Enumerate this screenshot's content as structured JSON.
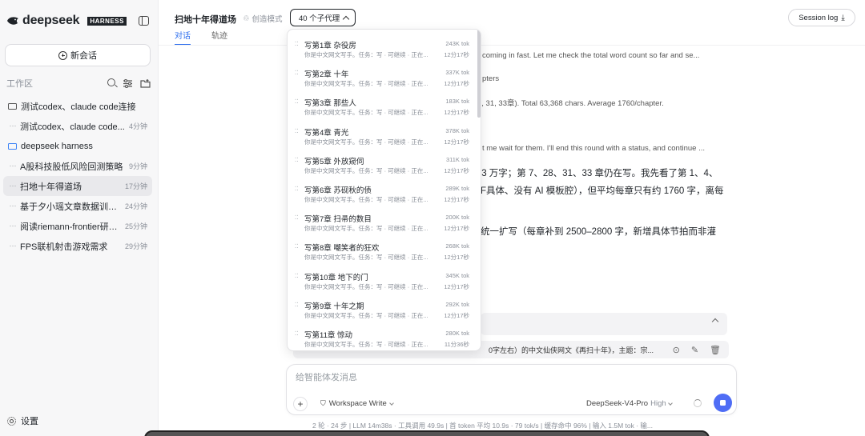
{
  "sidebar": {
    "brand": "deepseek",
    "badge": "HARNESS",
    "new_chat": "新会话",
    "workspace_label": "工作区",
    "items": [
      {
        "label": "测试codex、claude code连接",
        "time": "",
        "type": "folder"
      },
      {
        "label": "测试codex、claude code...",
        "time": "4分钟",
        "type": "session"
      },
      {
        "label": "deepseek harness",
        "time": "",
        "type": "folder-blue"
      },
      {
        "label": "A股科技股低风险回测策略",
        "time": "9分钟",
        "type": "session"
      },
      {
        "label": "扫地十年得道场",
        "time": "17分钟",
        "type": "session",
        "active": true
      },
      {
        "label": "基于夕小瑶文章数据训练...",
        "time": "24分钟",
        "type": "session"
      },
      {
        "label": "阅读riemann-frontier研究...",
        "time": "25分钟",
        "type": "session"
      },
      {
        "label": "FPS联机射击游戏需求",
        "time": "29分钟",
        "type": "session"
      }
    ],
    "settings": "设置"
  },
  "header": {
    "title": "扫地十年得道场",
    "mode": "创造模式",
    "agents": "40 个子代理",
    "tabs": [
      "对话",
      "轨迹"
    ],
    "session_log": "Session log"
  },
  "background": {
    "line1": "coming in fast. Let me check the total word count so far and se...",
    "line2": "pters",
    "line3": "8, 31, 33章). Total 63,368 chars. Average 1760/chapter.",
    "line4": "t me wait for them. I'll end this round with a status, and continue ...",
    "line5": ".3 万字；第 7、28、31、33 章仍在写。我先看了第 1、4、",
    "line6": "F具体、没有 AI 模板腔），但平均每章只有约 1760 字，离每",
    "line7": "统一扩写（每章补到 2500–2800 字，新增具体节拍而非灌",
    "task": "0字左右）的中文仙侠网文《再扫十年》，主题：宗..."
  },
  "composer": {
    "placeholder": "给智能体发消息",
    "mode": "Workspace Write",
    "model": "DeepSeek-V4-Pro",
    "level": "High"
  },
  "stats": "2 轮 · 24 步  |  LLM 14m38s · 工具调用 49.9s  |  首 token 平均 10.9s · 79 tok/s  |  缓存命中 96%  |  输入 1.5M tok · 输...",
  "dropdown": {
    "items": [
      {
        "title": "写第1章 杂役房",
        "desc": "你是中文网文写手。任务：写 · 可继续 · 正在...",
        "tok": "243K tok",
        "time": "12分17秒"
      },
      {
        "title": "写第2章 十年",
        "desc": "你是中文网文写手。任务：写 · 可继续 · 正在...",
        "tok": "337K tok",
        "time": "12分17秒"
      },
      {
        "title": "写第3章 那些人",
        "desc": "你是中文网文写手。任务：写 · 可继续 · 正在...",
        "tok": "183K tok",
        "time": "12分17秒"
      },
      {
        "title": "写第4章 青光",
        "desc": "你是中文网文写手。任务：写 · 可继续 · 正在...",
        "tok": "378K tok",
        "time": "12分17秒"
      },
      {
        "title": "写第5章 外放窥伺",
        "desc": "你是中文网文写手。任务：写 · 可继续 · 正在...",
        "tok": "311K tok",
        "time": "12分17秒"
      },
      {
        "title": "写第6章 苏砚秋的债",
        "desc": "你是中文网文写手。任务：写 · 可继续 · 正在...",
        "tok": "289K tok",
        "time": "12分17秒"
      },
      {
        "title": "写第7章 扫帚的数目",
        "desc": "你是中文网文写手。任务：写 · 可继续 · 正在...",
        "tok": "200K tok",
        "time": "12分17秒"
      },
      {
        "title": "写第8章 嘲笑者的狂欢",
        "desc": "你是中文网文写手。任务：写 · 可继续 · 正在...",
        "tok": "268K tok",
        "time": "12分17秒"
      },
      {
        "title": "写第10章 地下的门",
        "desc": "你是中文网文写手。任务：写 · 可继续 · 正在...",
        "tok": "345K tok",
        "time": "12分17秒"
      },
      {
        "title": "写第9章 十年之期",
        "desc": "你是中文网文写手。任务：写 · 可继续 · 正在...",
        "tok": "292K tok",
        "time": "12分17秒"
      },
      {
        "title": "写第11章 惊动",
        "desc": "你是中文网文写手。任务：写 · 可继续 · 正在...",
        "tok": "280K tok",
        "time": "11分36秒"
      }
    ]
  }
}
